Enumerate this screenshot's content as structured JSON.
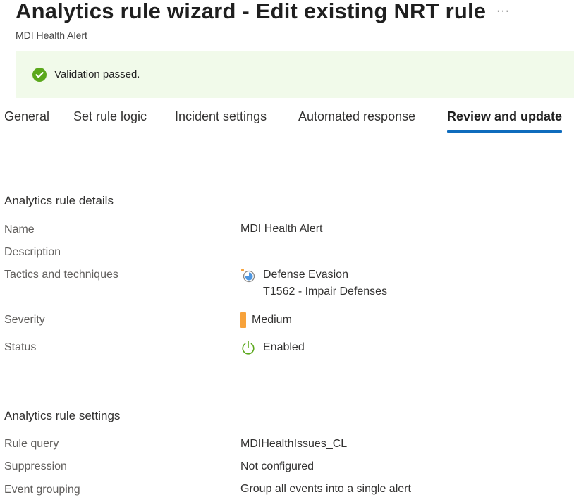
{
  "header": {
    "title": "Analytics rule wizard - Edit existing NRT rule",
    "more_label": "···",
    "subtitle": "MDI Health Alert"
  },
  "banner": {
    "message": "Validation passed.",
    "icon": "check-circle-icon",
    "color": "#5ba81c"
  },
  "tabs": [
    {
      "label": "General"
    },
    {
      "label": "Set rule logic"
    },
    {
      "label": "Incident settings"
    },
    {
      "label": "Automated response"
    },
    {
      "label": "Review and update",
      "active": true
    }
  ],
  "details": {
    "section_title": "Analytics rule details",
    "name_label": "Name",
    "name_value": "MDI Health Alert",
    "description_label": "Description",
    "tactics_label": "Tactics and techniques",
    "tactic": "Defense Evasion",
    "technique": "T1562 - Impair Defenses",
    "tactic_icon": "defense-evasion-icon",
    "severity_label": "Severity",
    "severity_value": "Medium",
    "severity_color": "#f7a23b",
    "status_label": "Status",
    "status_value": "Enabled",
    "status_icon": "power-icon",
    "status_color": "#5ba81c"
  },
  "settings": {
    "section_title": "Analytics rule settings",
    "query_label": "Rule query",
    "query_value": "MDIHealthIssues_CL",
    "suppression_label": "Suppression",
    "suppression_value": "Not configured",
    "grouping_label": "Event grouping",
    "grouping_value": "Group all events into a single alert"
  }
}
